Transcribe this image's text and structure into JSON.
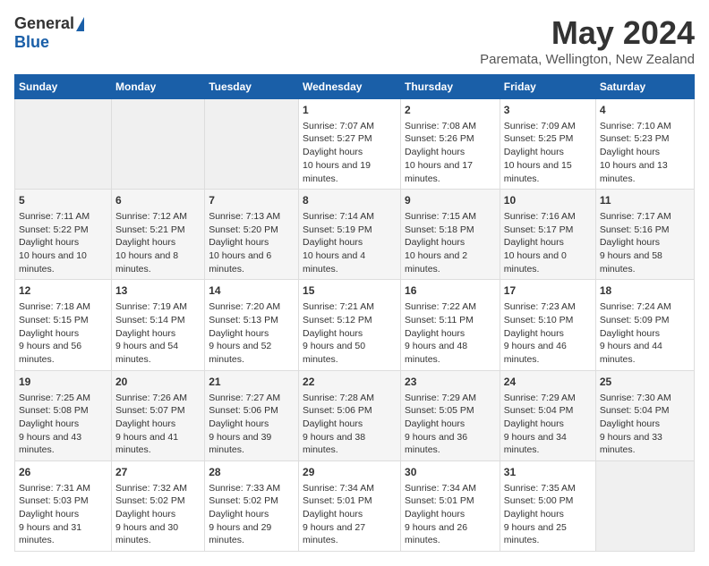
{
  "header": {
    "logo_general": "General",
    "logo_blue": "Blue",
    "month_title": "May 2024",
    "location": "Paremata, Wellington, New Zealand"
  },
  "days_of_week": [
    "Sunday",
    "Monday",
    "Tuesday",
    "Wednesday",
    "Thursday",
    "Friday",
    "Saturday"
  ],
  "weeks": [
    [
      {
        "day": "",
        "info": ""
      },
      {
        "day": "",
        "info": ""
      },
      {
        "day": "",
        "info": ""
      },
      {
        "day": "1",
        "sunrise": "7:07 AM",
        "sunset": "5:27 PM",
        "daylight": "10 hours and 19 minutes."
      },
      {
        "day": "2",
        "sunrise": "7:08 AM",
        "sunset": "5:26 PM",
        "daylight": "10 hours and 17 minutes."
      },
      {
        "day": "3",
        "sunrise": "7:09 AM",
        "sunset": "5:25 PM",
        "daylight": "10 hours and 15 minutes."
      },
      {
        "day": "4",
        "sunrise": "7:10 AM",
        "sunset": "5:23 PM",
        "daylight": "10 hours and 13 minutes."
      }
    ],
    [
      {
        "day": "5",
        "sunrise": "7:11 AM",
        "sunset": "5:22 PM",
        "daylight": "10 hours and 10 minutes."
      },
      {
        "day": "6",
        "sunrise": "7:12 AM",
        "sunset": "5:21 PM",
        "daylight": "10 hours and 8 minutes."
      },
      {
        "day": "7",
        "sunrise": "7:13 AM",
        "sunset": "5:20 PM",
        "daylight": "10 hours and 6 minutes."
      },
      {
        "day": "8",
        "sunrise": "7:14 AM",
        "sunset": "5:19 PM",
        "daylight": "10 hours and 4 minutes."
      },
      {
        "day": "9",
        "sunrise": "7:15 AM",
        "sunset": "5:18 PM",
        "daylight": "10 hours and 2 minutes."
      },
      {
        "day": "10",
        "sunrise": "7:16 AM",
        "sunset": "5:17 PM",
        "daylight": "10 hours and 0 minutes."
      },
      {
        "day": "11",
        "sunrise": "7:17 AM",
        "sunset": "5:16 PM",
        "daylight": "9 hours and 58 minutes."
      }
    ],
    [
      {
        "day": "12",
        "sunrise": "7:18 AM",
        "sunset": "5:15 PM",
        "daylight": "9 hours and 56 minutes."
      },
      {
        "day": "13",
        "sunrise": "7:19 AM",
        "sunset": "5:14 PM",
        "daylight": "9 hours and 54 minutes."
      },
      {
        "day": "14",
        "sunrise": "7:20 AM",
        "sunset": "5:13 PM",
        "daylight": "9 hours and 52 minutes."
      },
      {
        "day": "15",
        "sunrise": "7:21 AM",
        "sunset": "5:12 PM",
        "daylight": "9 hours and 50 minutes."
      },
      {
        "day": "16",
        "sunrise": "7:22 AM",
        "sunset": "5:11 PM",
        "daylight": "9 hours and 48 minutes."
      },
      {
        "day": "17",
        "sunrise": "7:23 AM",
        "sunset": "5:10 PM",
        "daylight": "9 hours and 46 minutes."
      },
      {
        "day": "18",
        "sunrise": "7:24 AM",
        "sunset": "5:09 PM",
        "daylight": "9 hours and 44 minutes."
      }
    ],
    [
      {
        "day": "19",
        "sunrise": "7:25 AM",
        "sunset": "5:08 PM",
        "daylight": "9 hours and 43 minutes."
      },
      {
        "day": "20",
        "sunrise": "7:26 AM",
        "sunset": "5:07 PM",
        "daylight": "9 hours and 41 minutes."
      },
      {
        "day": "21",
        "sunrise": "7:27 AM",
        "sunset": "5:06 PM",
        "daylight": "9 hours and 39 minutes."
      },
      {
        "day": "22",
        "sunrise": "7:28 AM",
        "sunset": "5:06 PM",
        "daylight": "9 hours and 38 minutes."
      },
      {
        "day": "23",
        "sunrise": "7:29 AM",
        "sunset": "5:05 PM",
        "daylight": "9 hours and 36 minutes."
      },
      {
        "day": "24",
        "sunrise": "7:29 AM",
        "sunset": "5:04 PM",
        "daylight": "9 hours and 34 minutes."
      },
      {
        "day": "25",
        "sunrise": "7:30 AM",
        "sunset": "5:04 PM",
        "daylight": "9 hours and 33 minutes."
      }
    ],
    [
      {
        "day": "26",
        "sunrise": "7:31 AM",
        "sunset": "5:03 PM",
        "daylight": "9 hours and 31 minutes."
      },
      {
        "day": "27",
        "sunrise": "7:32 AM",
        "sunset": "5:02 PM",
        "daylight": "9 hours and 30 minutes."
      },
      {
        "day": "28",
        "sunrise": "7:33 AM",
        "sunset": "5:02 PM",
        "daylight": "9 hours and 29 minutes."
      },
      {
        "day": "29",
        "sunrise": "7:34 AM",
        "sunset": "5:01 PM",
        "daylight": "9 hours and 27 minutes."
      },
      {
        "day": "30",
        "sunrise": "7:34 AM",
        "sunset": "5:01 PM",
        "daylight": "9 hours and 26 minutes."
      },
      {
        "day": "31",
        "sunrise": "7:35 AM",
        "sunset": "5:00 PM",
        "daylight": "9 hours and 25 minutes."
      },
      {
        "day": "",
        "info": ""
      }
    ]
  ]
}
